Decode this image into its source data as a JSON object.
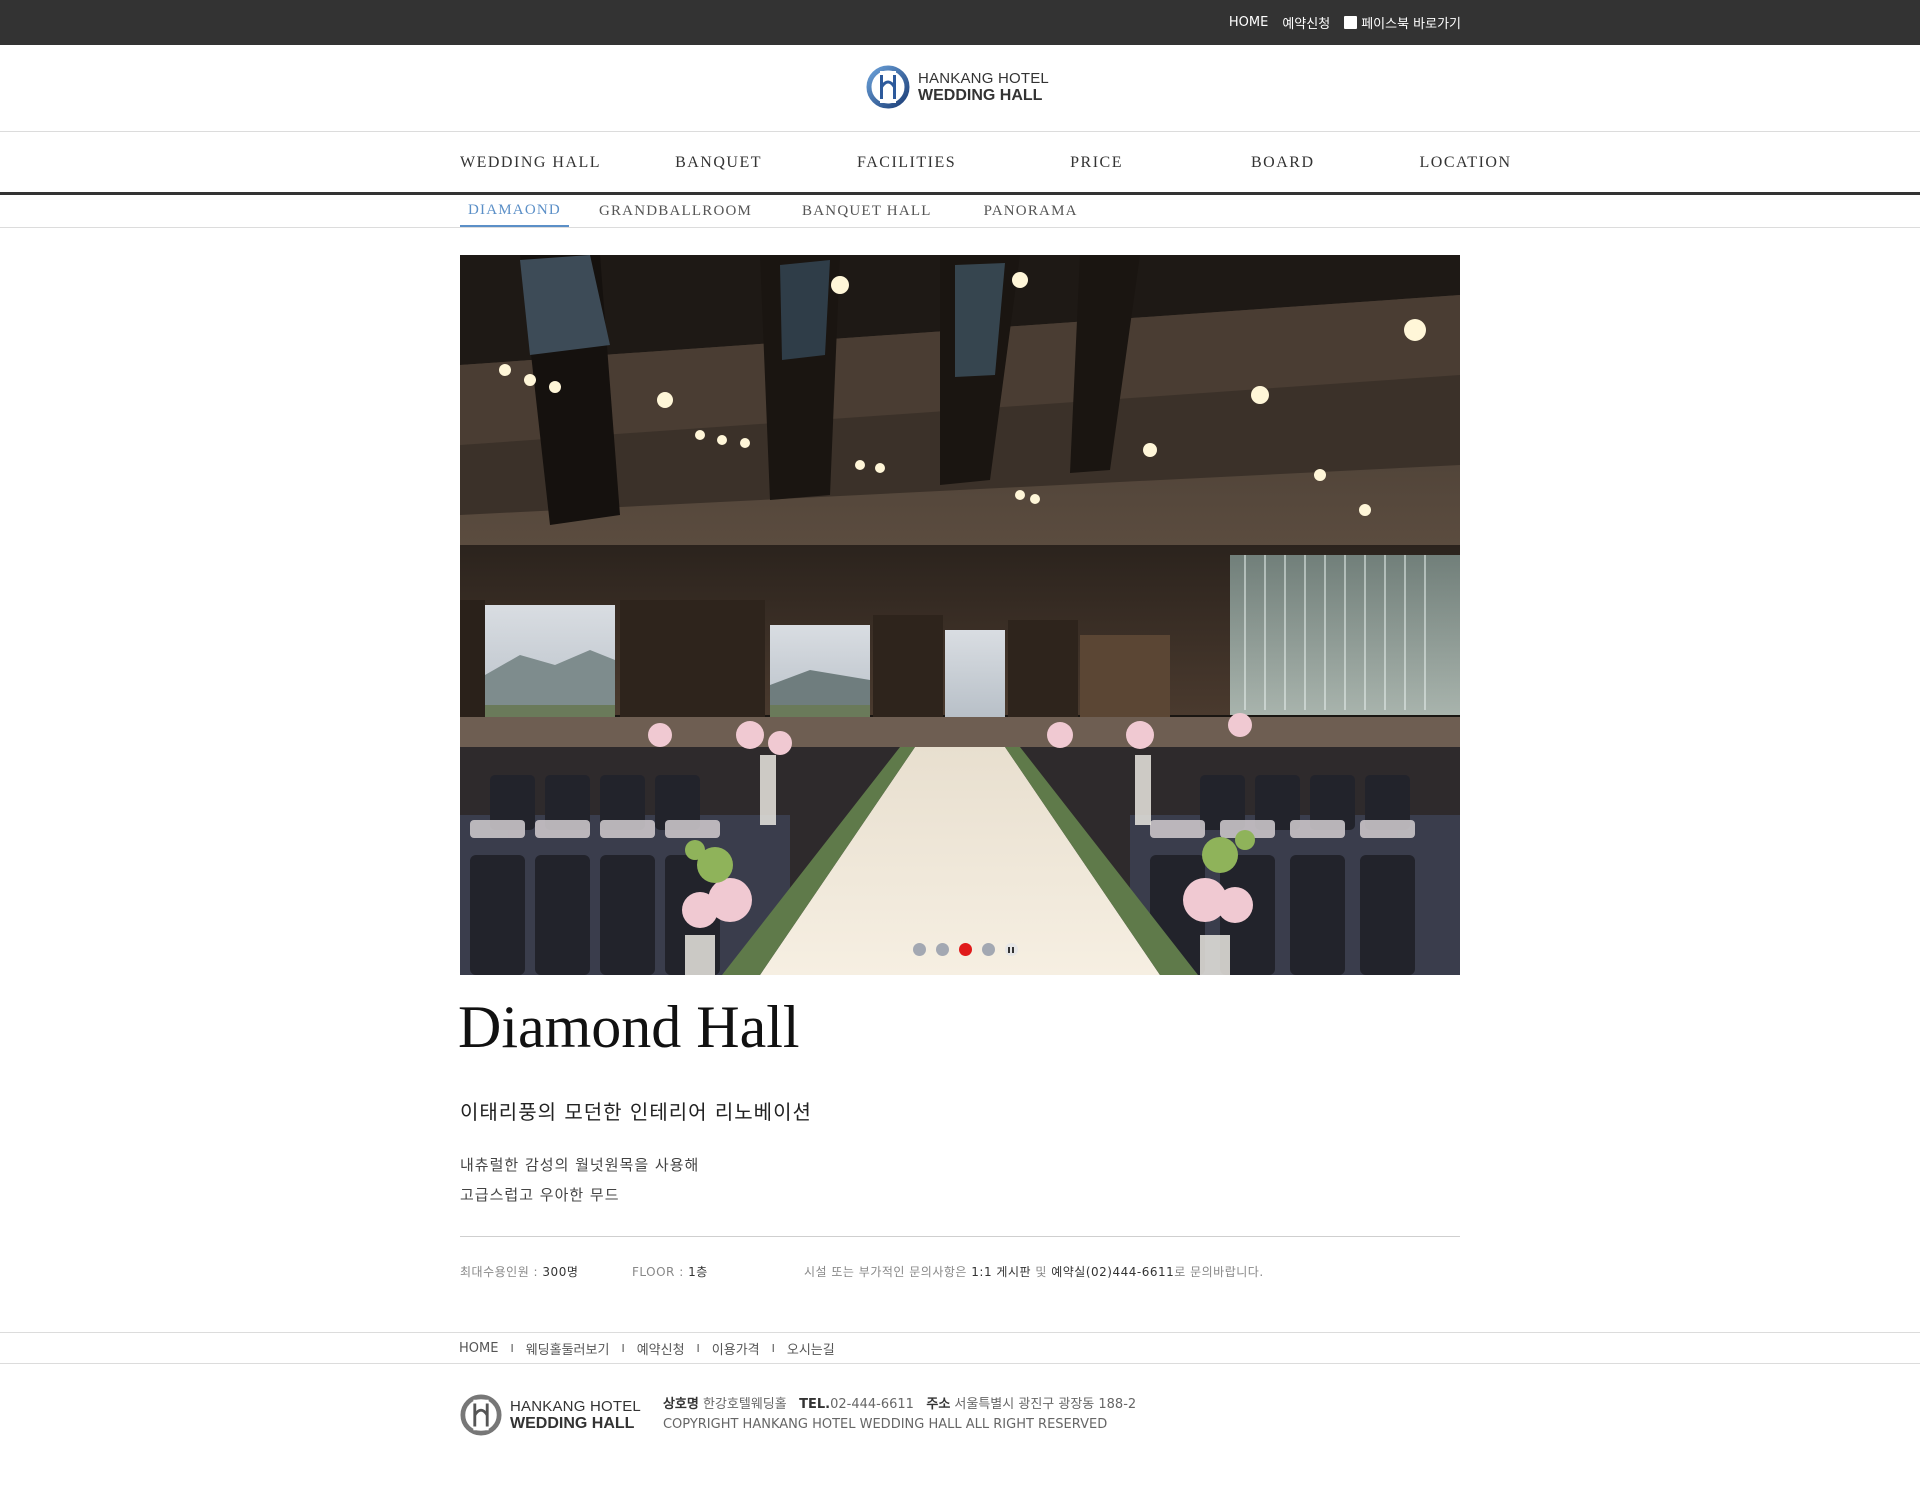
{
  "topbar": {
    "home": "HOME",
    "reserve": "예약신청",
    "facebook": "페이스북 바로가기",
    "facebook_icon": "facebook-icon"
  },
  "brand": {
    "line1": "HANKANG HOTEL",
    "line2": "WEDDING HALL",
    "logo_icon": "hankang-emblem-icon"
  },
  "main_nav": [
    "WEDDING HALL",
    "BANQUET",
    "FACILITIES",
    "PRICE",
    "BOARD",
    "LOCATION"
  ],
  "sub_nav": {
    "items": [
      "DIAMAOND",
      "GRANDBALLROOM",
      "BANQUET HALL",
      "PANORAMA"
    ],
    "active_index": 0
  },
  "slider": {
    "slide_count": 4,
    "active_index": 2,
    "pause_icon": "pause-icon"
  },
  "hall": {
    "title": "Diamond Hall",
    "subtitle": "이태리풍의 모던한 인테리어 리노베이션",
    "desc_line1": "내츄럴한 감성의 월넛원목을 사용해",
    "desc_line2": "고급스럽고 우아한 무드"
  },
  "info": {
    "capacity_label": "최대수용인원 : ",
    "capacity_value": "300명",
    "floor_label": "FLOOR : ",
    "floor_value": "1층",
    "inquiry_prefix": "시설 또는 부가적인 문의사항은 ",
    "inquiry_board": "1:1 게시판",
    "inquiry_and": " 및 ",
    "inquiry_phone": "예약실(02)444-6611",
    "inquiry_suffix": "로 문의바랍니다."
  },
  "footer_nav": [
    "HOME",
    "웨딩홀둘러보기",
    "예약신청",
    "이용가격",
    "오시는길"
  ],
  "footer_nav_separator": "I",
  "footer": {
    "company_label": "상호명",
    "company_value": "한강호텔웨딩홀",
    "tel_label": "TEL.",
    "tel_value": "02-444-6611",
    "address_label": "주소",
    "address_value": "서울특별시 광진구 광장동 188-2",
    "copyright": "COPYRIGHT HANKANG HOTEL WEDDING HALL ALL RIGHT RESERVED"
  },
  "colors": {
    "topbar_bg": "#333333",
    "accent_blue": "#5b8fc7",
    "slider_active_dot": "#e01a1a"
  }
}
